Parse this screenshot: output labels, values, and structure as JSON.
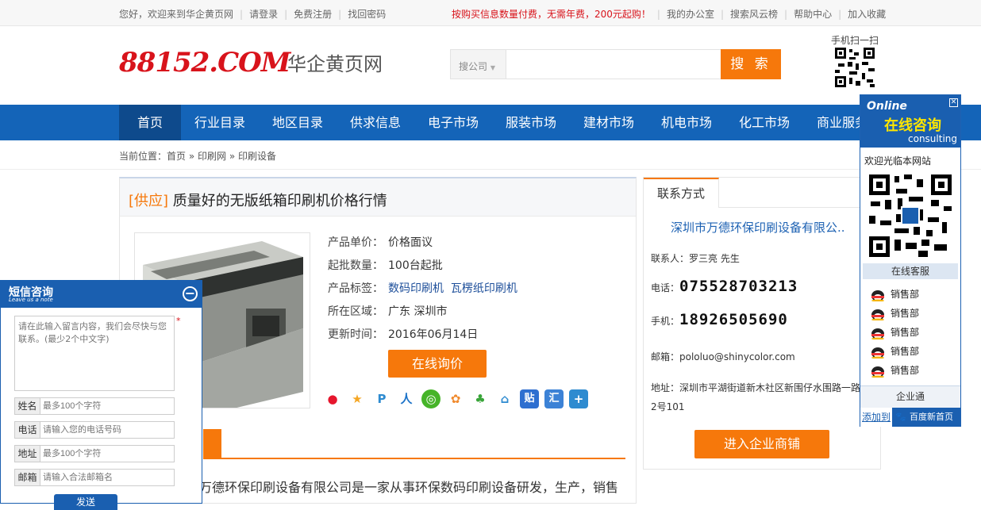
{
  "topbar": {
    "welcome": "您好，欢迎来到华企黄页网",
    "login": "请登录",
    "register": "免费注册",
    "recover": "找回密码",
    "promo": "按购买信息数量付费，无需年费，200元起购！",
    "office": "我的办公室",
    "cloud": "搜索风云榜",
    "help": "帮助中心",
    "favorite": "加入收藏"
  },
  "header": {
    "logo_text": "88152.COM",
    "site_name": "华企黄页网",
    "search_type": "搜公司",
    "search_value": "",
    "search_button": "搜 索",
    "qr_label": "手机扫一扫"
  },
  "nav": [
    "首页",
    "行业目录",
    "地区目录",
    "供求信息",
    "电子市场",
    "服装市场",
    "建材市场",
    "机电市场",
    "化工市场",
    "商业服务"
  ],
  "breadcrumb": {
    "label": "当前位置：",
    "home": "首页",
    "sep": "»",
    "cat": "印刷网",
    "sub": "印刷设备"
  },
  "product": {
    "tag": "[供应]",
    "title": "质量好的无版纸箱印刷机价格行情",
    "fields": [
      {
        "k": "产品单价：",
        "v": "价格面议"
      },
      {
        "k": "起批数量：",
        "v": "100台起批"
      },
      {
        "k": "产品标签：",
        "v": "数码印刷机  瓦楞纸印刷机"
      },
      {
        "k": "所在区域：",
        "v": "广东 深圳市"
      },
      {
        "k": "更新时间：",
        "v": "2016年06月14日"
      }
    ],
    "ask_button": "在线询价",
    "description": "万德环保印刷设备有限公司是一家从事环保数码印刷设备研发，生产，销售"
  },
  "contact": {
    "tab": "联系方式",
    "company": "深圳市万德环保印刷设备有限公..",
    "person_label": "联系人：",
    "person": "罗三亮 先生",
    "tel_label": "电话：",
    "tel": "075528703213",
    "mobile_label": "手机：",
    "mobile": "18926505690",
    "email_label": "邮箱：",
    "email": "pololuo@shinycolor.com",
    "addr_label": "地址：",
    "addr_line1": "深圳市平湖街道新木社区新围仔水围路一路",
    "addr_line2": "2号101",
    "enter_button": "进入企业商铺"
  },
  "float": {
    "online": "Online",
    "title": "在线咨询",
    "consult": "consulting",
    "welcome": "欢迎光临本网站",
    "service": "在线客服",
    "depts": [
      "销售部",
      "销售部",
      "销售部",
      "销售部",
      "销售部"
    ],
    "qybt": "企业通",
    "add": "添加到",
    "baidu": "百度新首页"
  },
  "sms": {
    "title": "短信咨询",
    "subtitle": "Leave us a note",
    "message_placeholder": "请在此输入留言内容，我们会尽快与您联系。(最少2个中文字)",
    "name_label": "姓名",
    "name_placeholder": "最多100个字符",
    "phone_label": "电话",
    "phone_placeholder": "请输入您的电话号码",
    "addr_label": "地址",
    "addr_placeholder": "最多100个字符",
    "email_label": "邮箱",
    "email_placeholder": "请输入合法邮箱名",
    "send": "发送"
  },
  "colors": {
    "brand_blue": "#1464b8",
    "accent_orange": "#f6780b",
    "logo_red": "#d8131b"
  },
  "share_icons": [
    "weibo-icon",
    "qzone-icon",
    "pengyou-icon",
    "renren-icon",
    "wechat-icon",
    "kaixin-icon",
    "clover-icon",
    "house-icon",
    "tieba-icon",
    "huiyou-icon",
    "more-icon"
  ]
}
